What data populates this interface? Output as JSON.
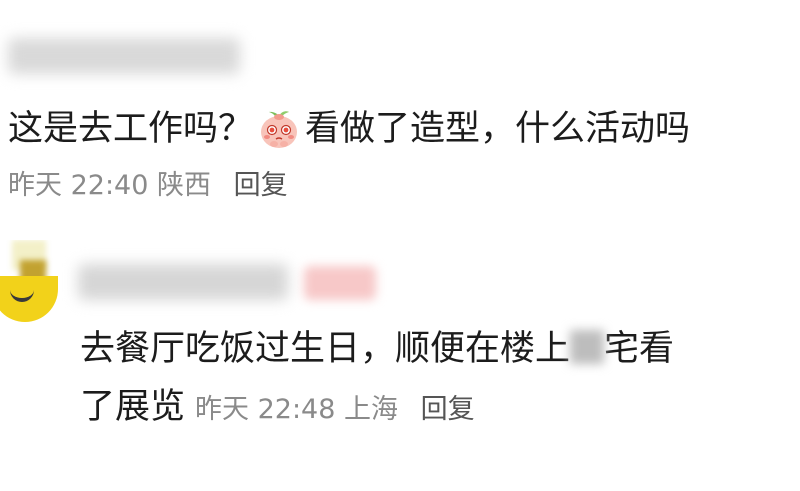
{
  "comment1": {
    "text_before_emoji": "这是去工作吗？",
    "emoji": "blushing-peach-emoji",
    "text_after_emoji": "看做了造型，什么活动吗",
    "time": "昨天 22:40",
    "location": "陕西",
    "reply_label": "回复"
  },
  "comment2": {
    "text_line1_part1": "去餐厅吃饭过生日，顺便在楼上",
    "text_line1_part2": "宅看",
    "text_line2": "了展览",
    "time": "昨天 22:48",
    "location": "上海",
    "reply_label": "回复"
  },
  "colors": {
    "text": "#1c1c1c",
    "meta": "#8a8a8a",
    "avatar": "#f2d21a"
  }
}
